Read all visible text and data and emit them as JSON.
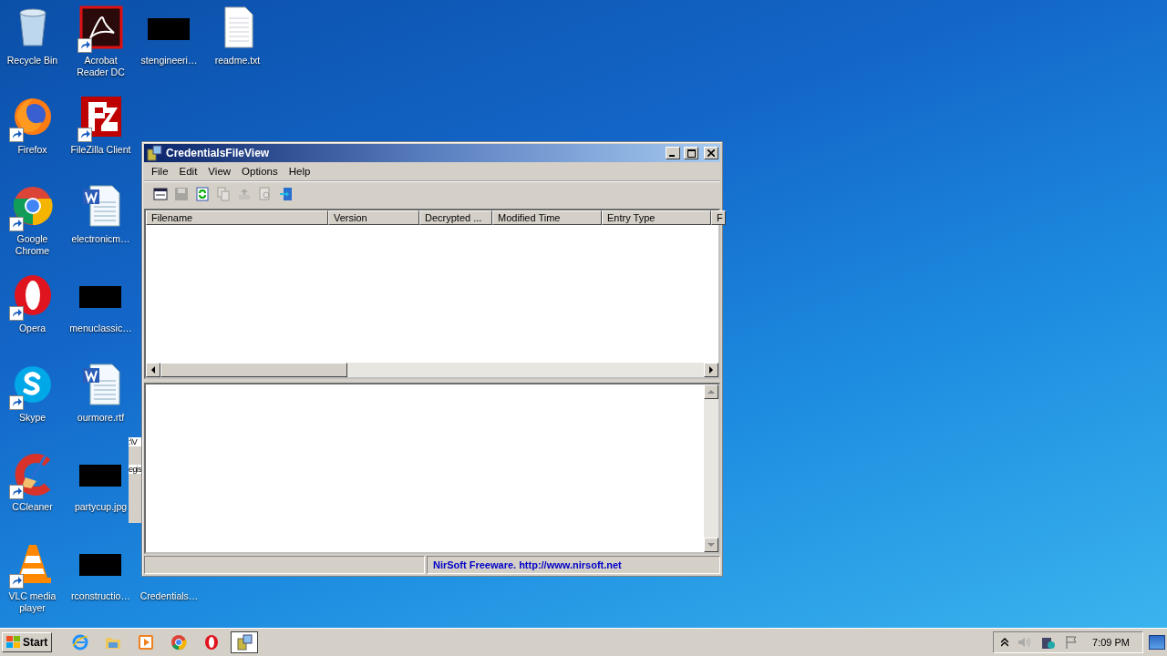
{
  "desktop": {
    "icon_columns": [
      [
        {
          "kind": "recycle-bin",
          "label": "Recycle Bin",
          "shortcut": false
        },
        {
          "kind": "firefox",
          "label": "Firefox",
          "shortcut": true
        },
        {
          "kind": "chrome",
          "label": "Google Chrome",
          "shortcut": true
        },
        {
          "kind": "opera",
          "label": "Opera",
          "shortcut": true
        },
        {
          "kind": "skype",
          "label": "Skype",
          "shortcut": true
        },
        {
          "kind": "ccleaner",
          "label": "CCleaner",
          "shortcut": true
        },
        {
          "kind": "vlc",
          "label": "VLC media player",
          "shortcut": true
        }
      ],
      [
        {
          "kind": "acrobat",
          "label": "Acrobat Reader DC",
          "shortcut": true
        },
        {
          "kind": "filezilla",
          "label": "FileZilla Client",
          "shortcut": true
        },
        {
          "kind": "word",
          "label": "electronicm…",
          "shortcut": false
        },
        {
          "kind": "redacted",
          "label": "menuclassic…",
          "shortcut": false
        },
        {
          "kind": "word",
          "label": "ourmore.rtf",
          "shortcut": false
        },
        {
          "kind": "redacted",
          "label": "partycup.jpg",
          "shortcut": false
        },
        {
          "kind": "redacted",
          "label": "rconstructio…",
          "shortcut": false
        }
      ],
      [
        {
          "kind": "redacted",
          "label": "stengineeri…",
          "shortcut": false
        },
        {
          "kind": "gap"
        },
        {
          "kind": "gap"
        },
        {
          "kind": "gap"
        },
        {
          "kind": "gap"
        },
        {
          "kind": "gap"
        },
        {
          "kind": "hidden",
          "label": "Credentials…",
          "shortcut": false
        }
      ],
      [
        {
          "kind": "text-file",
          "label": "readme.txt",
          "shortcut": false
        }
      ]
    ],
    "background_window": {
      "lines": [
        ":\\V",
        "egis"
      ]
    }
  },
  "window": {
    "title": "CredentialsFileView",
    "menu": [
      "File",
      "Edit",
      "View",
      "Options",
      "Help"
    ],
    "toolbar": [
      {
        "kind": "properties",
        "disabled": false
      },
      {
        "kind": "save",
        "disabled": true
      },
      {
        "kind": "refresh",
        "disabled": false
      },
      {
        "kind": "copy",
        "disabled": true
      },
      {
        "kind": "export",
        "disabled": true
      },
      {
        "kind": "find",
        "disabled": true
      },
      {
        "kind": "exit",
        "disabled": false
      }
    ],
    "table": {
      "columns": [
        "Filename",
        "Version",
        "Decrypted ...",
        "Modified Time",
        "Entry Type",
        "F"
      ]
    },
    "status_bar": {
      "text": "NirSoft Freeware.  http://www.nirsoft.net"
    }
  },
  "taskbar": {
    "start": "Start",
    "items": [
      {
        "kind": "ie",
        "selected": false
      },
      {
        "kind": "folder",
        "selected": false
      },
      {
        "kind": "media",
        "selected": false
      },
      {
        "kind": "chrome",
        "selected": false
      },
      {
        "kind": "opera",
        "selected": false
      },
      {
        "kind": "app",
        "selected": true
      }
    ],
    "clock": "7:09 PM"
  }
}
